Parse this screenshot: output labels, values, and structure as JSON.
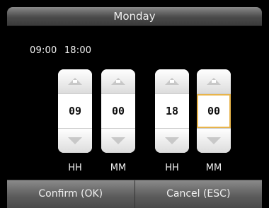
{
  "header": {
    "title": "Monday"
  },
  "time_range": {
    "start": "09:00",
    "end": "18:00"
  },
  "spinners": [
    {
      "value": "09",
      "unit": "HH",
      "selected": false
    },
    {
      "value": "00",
      "unit": "MM",
      "selected": false
    },
    {
      "value": "18",
      "unit": "HH",
      "selected": false
    },
    {
      "value": "00",
      "unit": "MM",
      "selected": true
    }
  ],
  "footer": {
    "confirm_label": "Confirm (OK)",
    "cancel_label": "Cancel (ESC)"
  },
  "colors": {
    "selection_border": "#e8b44b",
    "title_bar": "#6b6b6b",
    "background": "#000000"
  },
  "icons": {
    "increment": "triangle-up-icon",
    "decrement": "triangle-down-icon"
  }
}
